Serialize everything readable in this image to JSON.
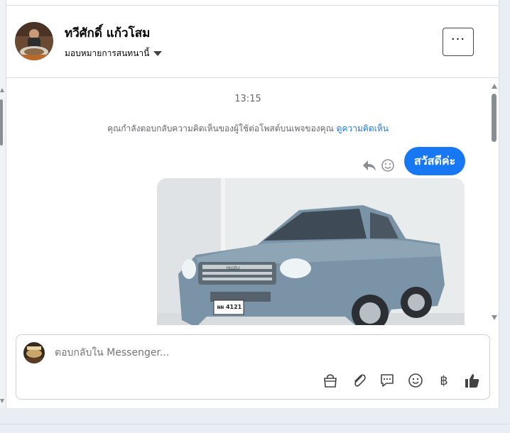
{
  "header": {
    "name": "ทวีศักดิ์ แก้วโสม",
    "assign_label": "มอบหมายการสนทนานี้",
    "more_label": "···"
  },
  "conversation": {
    "timestamp": "13:15",
    "context_text": "คุณกำลังตอบกลับความคิดเห็นของผู้ใช้ต่อโพสต์บนเพจของคุณ ",
    "context_link": "ดูความคิดเห็น",
    "message": "สวัสดีค่ะ",
    "photo": {
      "plate_text": "ผผ 4121",
      "brand_text": "ISUZU"
    }
  },
  "composer": {
    "placeholder": "ตอบกลับใน Messenger...",
    "baht_glyph": "฿"
  },
  "icons": [
    "more-icon",
    "caret-down-icon",
    "reply-icon",
    "emoji-icon",
    "shop-bag-icon",
    "attach-icon",
    "saved-reply-icon",
    "smile-icon",
    "baht-icon",
    "like-icon"
  ],
  "colors": {
    "accent": "#1877f2",
    "secondary_text": "#65676b",
    "border": "#dadde1"
  }
}
